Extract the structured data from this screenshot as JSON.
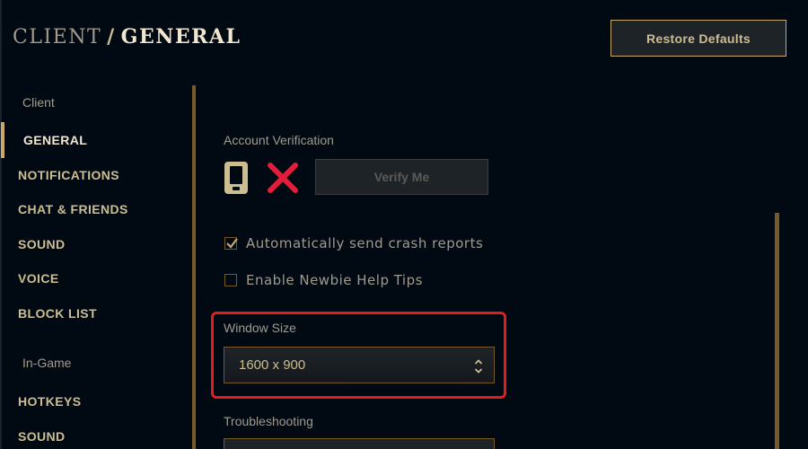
{
  "header": {
    "crumb": "CLIENT",
    "separator": "/",
    "current": "GENERAL",
    "restore_label": "Restore Defaults"
  },
  "sidebar": {
    "client_label": "Client",
    "client_items": [
      "GENERAL",
      "NOTIFICATIONS",
      "CHAT & FRIENDS",
      "SOUND",
      "VOICE",
      "BLOCK LIST"
    ],
    "ingame_label": "In-Game",
    "ingame_items": [
      "HOTKEYS",
      "SOUND"
    ],
    "active_item": "GENERAL"
  },
  "account_verification": {
    "label": "Account Verification",
    "verify_label": "Verify Me",
    "status": "not verified",
    "icons": [
      "phone-icon",
      "x-icon"
    ]
  },
  "checkboxes": [
    {
      "label": "Automatically send crash reports",
      "checked": true
    },
    {
      "label": "Enable Newbie Help Tips",
      "checked": false
    }
  ],
  "window_size": {
    "label": "Window Size",
    "value": "1600 x 900"
  },
  "troubleshooting": {
    "label": "Troubleshooting"
  },
  "colors": {
    "gold": "#c8aa6e",
    "gold_dark": "#785a28",
    "text_light": "#f0e6d2",
    "text_muted": "#a09b8c",
    "background": "#010a13",
    "highlight": "#e31d1d"
  }
}
